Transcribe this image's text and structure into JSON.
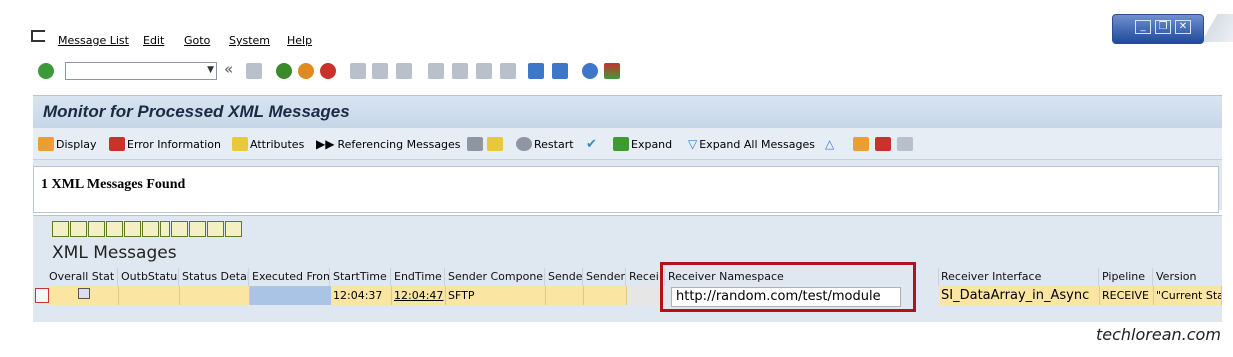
{
  "menu": {
    "items": [
      "Message List",
      "Edit",
      "Goto",
      "System",
      "Help"
    ]
  },
  "window_controls": {
    "minimize": "_",
    "restore": "❐",
    "close": "✕"
  },
  "std_toolbar": {
    "icons": [
      "check-icon",
      "back-icon",
      "save-icon",
      "back-nav-icon",
      "exit-icon",
      "cancel-icon",
      "print-icon",
      "find-icon",
      "find-next-icon",
      "first-page-icon",
      "prev-page-icon",
      "next-page-icon",
      "last-page-icon",
      "new-session-icon",
      "shortcut-icon",
      "help-icon",
      "customize-icon"
    ],
    "command_value": "",
    "back_arrows": "«"
  },
  "page": {
    "title": "Monitor for Processed XML Messages"
  },
  "app_toolbar": {
    "display": "Display",
    "error_info": "Error Information",
    "attributes": "Attributes",
    "referencing": "Referencing Messages",
    "restart": "Restart",
    "expand": "Expand",
    "expand_all": "Expand All Messages"
  },
  "result": {
    "found_text": "1 XML Messages Found"
  },
  "list": {
    "title": "XML Messages",
    "columns": [
      "Overall Stat",
      "OutbStatus",
      "Status Detai",
      "Executed From",
      "StartTime",
      "EndTime",
      "Sender Component",
      "Sende",
      "Sender",
      "Recei",
      "Receiver Namespace",
      "Receiver Interface",
      "Pipeline",
      "Version"
    ],
    "row": {
      "start_time": "12:04:37",
      "end_time": "12:04:47",
      "sender_component": "SFTP",
      "receiver_namespace": "http://random.com/test/module",
      "receiver_interface": "SI_DataArray_in_Async",
      "pipeline": "RECEIVE",
      "version": "\"Current Stat"
    }
  },
  "watermark": "techlorean.com"
}
